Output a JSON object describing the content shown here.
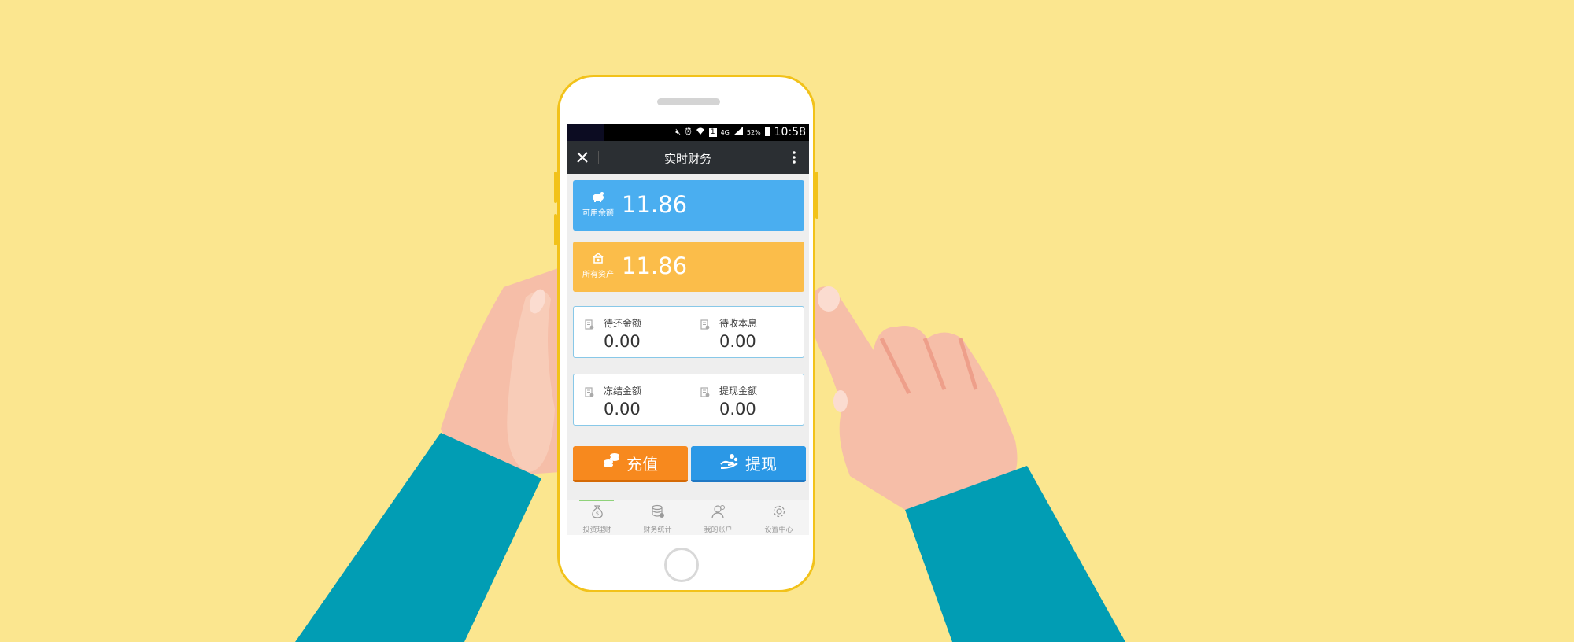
{
  "colors": {
    "background": "#fbe68f",
    "phone_frame": "#f2c21a",
    "sleeve": "#019db4",
    "skin": "#f6bea8",
    "title_bar": "#2b2f33",
    "card_available": "#4aaef0",
    "card_assets": "#fbbd4a",
    "recharge": "#f7891e",
    "withdraw": "#2b98e6"
  },
  "status_bar": {
    "network": "4G",
    "battery": "52%",
    "time": "10:58",
    "icons": [
      "mute-icon",
      "alarm-icon",
      "wifi-icon",
      "sim-icon",
      "signal-icon",
      "battery-icon"
    ]
  },
  "title_bar": {
    "title": "实时财务",
    "close_icon": "close-icon",
    "more_icon": "more-icon"
  },
  "balances": {
    "available": {
      "label": "可用余额",
      "value": "11.86",
      "icon": "piggy-bank-icon"
    },
    "total_assets": {
      "label": "所有资产",
      "value": "11.86",
      "icon": "assets-icon"
    }
  },
  "details": {
    "pending_repayment": {
      "label": "待还金额",
      "value": "0.00"
    },
    "pending_interest": {
      "label": "待收本息",
      "value": "0.00"
    },
    "frozen": {
      "label": "冻结金额",
      "value": "0.00"
    },
    "withdrawn": {
      "label": "提现金额",
      "value": "0.00"
    }
  },
  "actions": {
    "recharge": {
      "label": "充值",
      "icon": "coins-icon"
    },
    "withdraw": {
      "label": "提现",
      "icon": "hand-coin-icon"
    }
  },
  "bottom_nav": [
    {
      "label": "投资理财",
      "icon": "money-bag-icon"
    },
    {
      "label": "财务统计",
      "icon": "database-icon"
    },
    {
      "label": "我的账户",
      "icon": "user-icon"
    },
    {
      "label": "设置中心",
      "icon": "gear-icon"
    }
  ]
}
